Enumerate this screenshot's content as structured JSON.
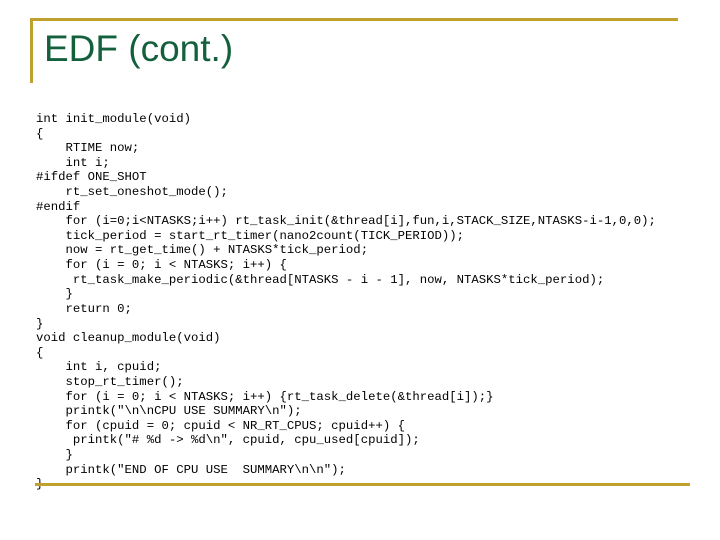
{
  "slide": {
    "title": "EDF (cont.)",
    "accent_color": "#bfa22e",
    "title_color": "#14603c",
    "code_color": "#000000",
    "background_color": "#ffffff"
  },
  "code": {
    "language": "c",
    "lines": [
      "int init_module(void)",
      "{",
      "    RTIME now;",
      "    int i;",
      "#ifdef ONE_SHOT",
      "    rt_set_oneshot_mode();",
      "#endif",
      "    for (i=0;i<NTASKS;i++) rt_task_init(&thread[i],fun,i,STACK_SIZE,NTASKS-i-1,0,0);",
      "    tick_period = start_rt_timer(nano2count(TICK_PERIOD));",
      "    now = rt_get_time() + NTASKS*tick_period;",
      "    for (i = 0; i < NTASKS; i++) {",
      "     rt_task_make_periodic(&thread[NTASKS - i - 1], now, NTASKS*tick_period);",
      "    }",
      "    return 0;",
      "}",
      "void cleanup_module(void)",
      "{",
      "    int i, cpuid;",
      "    stop_rt_timer();",
      "    for (i = 0; i < NTASKS; i++) {rt_task_delete(&thread[i]);}",
      "    printk(\"\\n\\nCPU USE SUMMARY\\n\");",
      "    for (cpuid = 0; cpuid < NR_RT_CPUS; cpuid++) {",
      "     printk(\"# %d -> %d\\n\", cpuid, cpu_used[cpuid]);",
      "    }",
      "    printk(\"END OF CPU USE  SUMMARY\\n\\n\");",
      "}"
    ]
  }
}
